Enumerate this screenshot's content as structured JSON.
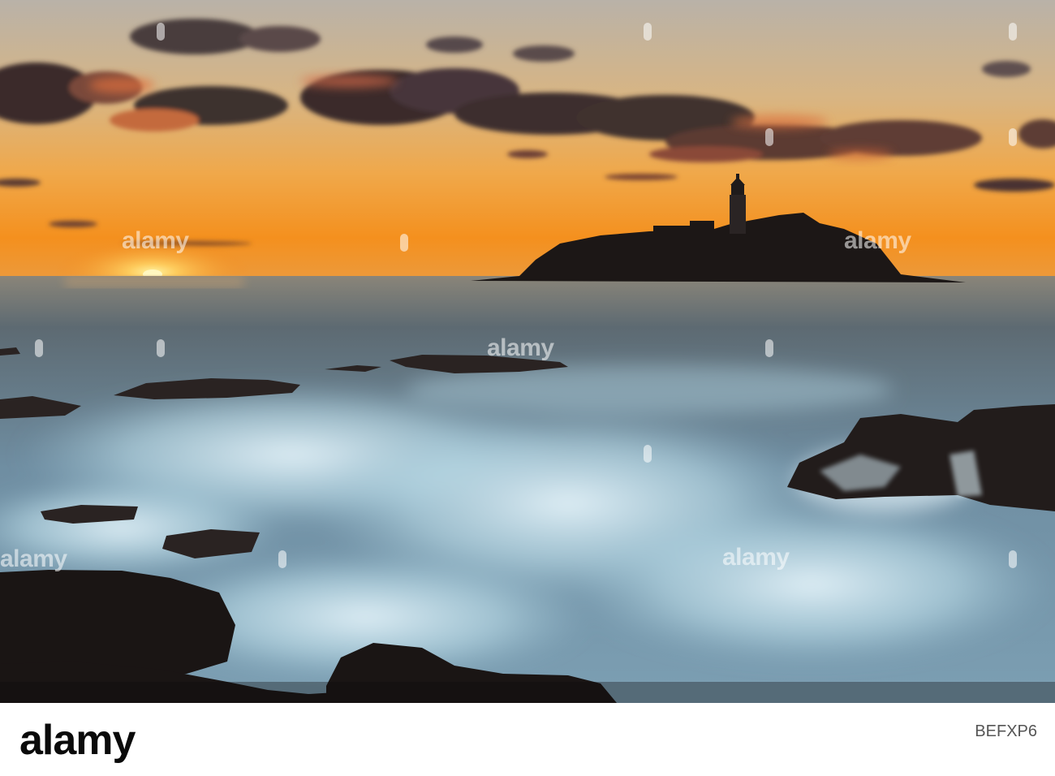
{
  "scene": {
    "subject": "lighthouse",
    "palette": {
      "sky_high": "#c9bcae",
      "sky_mid": "#f0a84a",
      "horizon": "#f48a1c",
      "sun": "#ffe36b",
      "cloud": "#3a2c2c",
      "cloud_glow": "#d9703f",
      "sea": "#4d6677",
      "surf": "#bcdde9",
      "rock": "#1c1716"
    }
  },
  "watermark": {
    "brand": "alamy"
  },
  "footer": {
    "logo": "alamy",
    "image_id_prefix": "",
    "image_id": "BEFXP6"
  }
}
